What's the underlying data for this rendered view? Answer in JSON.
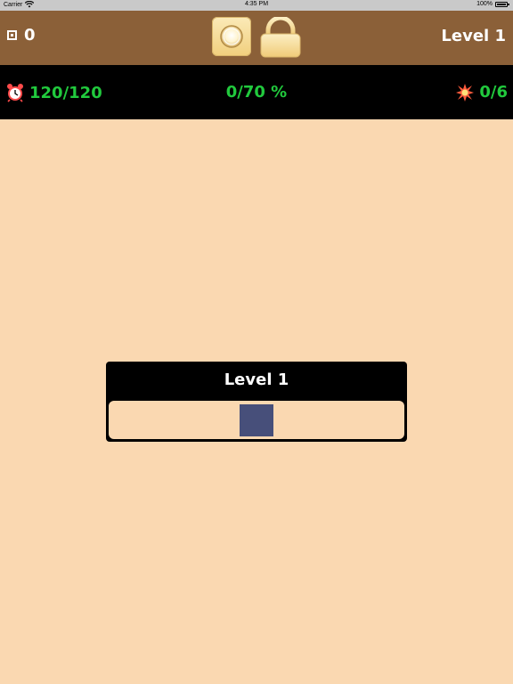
{
  "status_bar": {
    "carrier": "Carrier",
    "time": "4:35 PM",
    "battery": "100%"
  },
  "top_bar": {
    "score_icon": "square-icon",
    "score": "0",
    "light_button_icon": "lightbulb-icon",
    "lock_button_icon": "lock-icon",
    "level": "Level 1"
  },
  "stats_bar": {
    "timer_icon": "alarm-clock-icon",
    "timer": "120/120",
    "progress": "0/70 %",
    "hits_icon": "explosion-icon",
    "hits": "0/6"
  },
  "level_panel": {
    "title": "Level 1",
    "slots_filled": 1
  },
  "colors": {
    "background": "#fad8b1",
    "top_bar": "#8b6038",
    "stats_bar": "#000000",
    "stats_text": "#21c93d",
    "slot": "#474f7a"
  }
}
